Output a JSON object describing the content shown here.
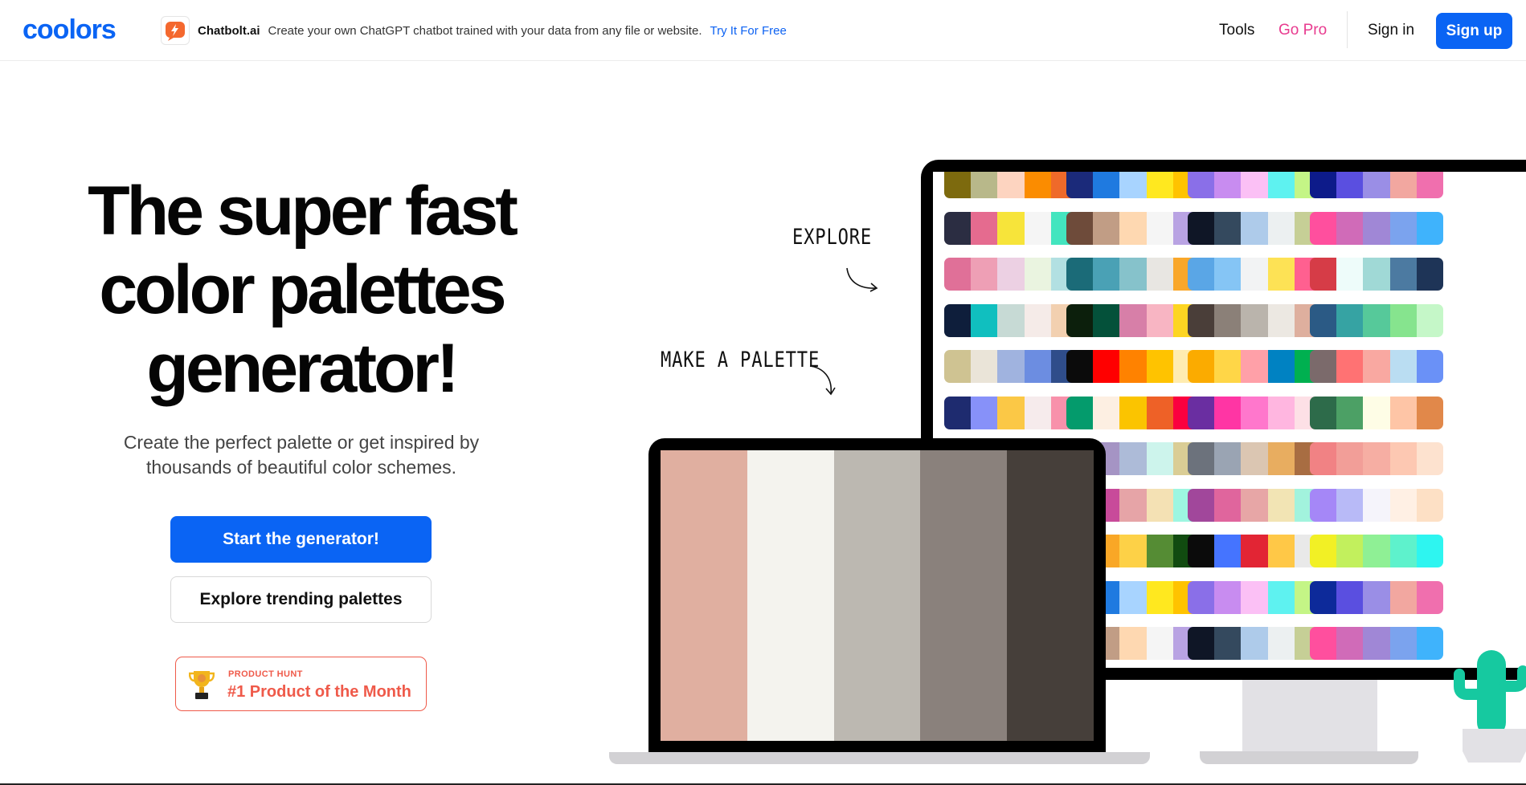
{
  "header": {
    "logo_text": "coolors",
    "ad": {
      "brand": "Chatbolt.ai",
      "text": "Create your own ChatGPT chatbot trained with your data from any file or website.",
      "link": "Try It For Free"
    },
    "nav": {
      "tools": "Tools",
      "go_pro": "Go Pro",
      "sign_in": "Sign in",
      "sign_up": "Sign up"
    }
  },
  "hero": {
    "title_lines": [
      "The super fast",
      "color palettes",
      "generator!"
    ],
    "subtitle_lines": [
      "Create the perfect palette or get inspired by",
      "thousands of beautiful color schemes."
    ],
    "primary_button": "Start the generator!",
    "secondary_button": "Explore trending palettes",
    "badge": {
      "label": "PRODUCT HUNT",
      "title": "#1 Product of the Month"
    }
  },
  "illustration": {
    "explore_label": "EXPLORE",
    "make_label": "MAKE A PALETTE",
    "laptop_palette": [
      "#e0afa0",
      "#f4f3ee",
      "#bcb8b1",
      "#8a817c",
      "#463f3a"
    ],
    "monitor_palettes": [
      [
        [
          "#7d6a0e",
          "#b8b88a",
          "#fdd4c0",
          "#fb8c00",
          "#ef6a2a"
        ],
        [
          "#1b2a7a",
          "#1f7ae0",
          "#a8d4ff",
          "#ffe81f",
          "#ffc300"
        ],
        [
          "#8a6fe8",
          "#c88cf0",
          "#fbc0f5",
          "#5ef2f0",
          "#c4f586"
        ],
        [
          "#0d1b8a",
          "#5a4fe0",
          "#9a8ee6",
          "#f2a7a0",
          "#f06fae"
        ]
      ],
      [
        [
          "#2b2d42",
          "#e56b8f",
          "#f7e43a",
          "#f5f5f5",
          "#43e5bf"
        ],
        [
          "#6e4b3a",
          "#c19d85",
          "#fed8b1",
          "#f5f5f5",
          "#b9a3e3"
        ],
        [
          "#0f1626",
          "#34495e",
          "#aecbea",
          "#ecf0f1",
          "#c6cf96"
        ],
        [
          "#ff4f9e",
          "#d06bb8",
          "#a087d6",
          "#7ba3ee",
          "#3fb3fc"
        ]
      ],
      [
        [
          "#e07098",
          "#ee9fb5",
          "#ecd0e3",
          "#eaf4e0",
          "#b2e0e2"
        ],
        [
          "#1b6b78",
          "#4aa1b5",
          "#86c2cb",
          "#e8e6e2",
          "#f9a72a"
        ],
        [
          "#5aa6e6",
          "#85c5f5",
          "#f2f3f4",
          "#fde255",
          "#ff6090"
        ],
        [
          "#d63c47",
          "#eefcfa",
          "#a0d9d6",
          "#4c7aa1",
          "#1e3457"
        ]
      ],
      [
        [
          "#0e1e3b",
          "#10bfbf",
          "#c7dad5",
          "#f5ebe8",
          "#f2d0b0"
        ],
        [
          "#0c1f0c",
          "#04513a",
          "#d77fa8",
          "#f8b5c3",
          "#fdd522"
        ],
        [
          "#4a3e39",
          "#8b8078",
          "#bab4ac",
          "#ece8e2",
          "#deaf9e"
        ],
        [
          "#2b5a85",
          "#36a3a3",
          "#56c99a",
          "#86e48e",
          "#c5f7c8"
        ]
      ],
      [
        [
          "#cfc392",
          "#eae4d8",
          "#a0b3df",
          "#6c8de1",
          "#2f4d8a"
        ],
        [
          "#0b0b0b",
          "#ff0000",
          "#ff8200",
          "#ffc300",
          "#ffecb0"
        ],
        [
          "#fbab00",
          "#ffd647",
          "#ffa0a8",
          "#0082c2",
          "#00b050"
        ],
        [
          "#7b6a6b",
          "#ff7273",
          "#f9a8a1",
          "#baddf2",
          "#6a91f7"
        ]
      ],
      [
        [
          "#1e2b6f",
          "#8791f9",
          "#fbc846",
          "#f6ebec",
          "#f891ab"
        ],
        [
          "#049b6c",
          "#fdefe2",
          "#fbc400",
          "#ee6127",
          "#fb003f"
        ],
        [
          "#6a2ea1",
          "#ff35a4",
          "#ff77cc",
          "#ffb6e0",
          "#fde0e6"
        ],
        [
          "#2d6b4a",
          "#4ca065",
          "#fefde6",
          "#fec5a6",
          "#e1884a"
        ]
      ],
      [
        [
          "#9fe6d6",
          "#c8f0e8",
          "#f6f6f6",
          "#ffd6d6",
          "#ffa7a7"
        ],
        [
          "#6e5d8c",
          "#a594c4",
          "#adbbd8",
          "#cdf4ec",
          "#dacd95"
        ],
        [
          "#6c727c",
          "#9aa4b3",
          "#dbc6b2",
          "#e8ad60",
          "#a86d42"
        ],
        [
          "#f18284",
          "#f29e98",
          "#f6aea3",
          "#fdc8b2",
          "#fde2cf"
        ]
      ],
      [
        [
          "#f15d5d",
          "#ff6b6b",
          "#e29598",
          "#d3b4bb",
          "#a0f0f4"
        ],
        [
          "#ab1e6e",
          "#c84a9a",
          "#e6a4a7",
          "#f4e1b4",
          "#9df6e1"
        ],
        [
          "#a1479b",
          "#e0659d",
          "#e7a6a6",
          "#f2e4b4",
          "#a2f3dd"
        ],
        [
          "#a587f7",
          "#b8baf7",
          "#f5f4fb",
          "#fff0e4",
          "#fde0c5"
        ]
      ],
      [
        [
          "#f7a23b",
          "#a8dbe2",
          "#f9a726",
          "#fdd147",
          "#558c34"
        ],
        [
          "#a8dbe2",
          "#f9a726",
          "#fdd147",
          "#558c34",
          "#114b10"
        ],
        [
          "#0b0b0b",
          "#4574ff",
          "#e22534",
          "#ffc847",
          "#e9e9e9"
        ],
        [
          "#f2f025",
          "#c2f05d",
          "#8ff095",
          "#5ef2cc",
          "#2ef5f0"
        ]
      ],
      [
        [
          "#1b2a7a",
          "#1f7ae0",
          "#a8d4ff",
          "#ffe81f",
          "#ffc300"
        ],
        [
          "#1b2a7a",
          "#1f7ae0",
          "#a8d4ff",
          "#ffe81f",
          "#ffc300"
        ],
        [
          "#8a6fe8",
          "#c88cf0",
          "#fbc0f5",
          "#5ef2f0",
          "#c4f586"
        ],
        [
          "#0d2a9a",
          "#5a4fe0",
          "#9a8ee6",
          "#f2a7a0",
          "#f06fae"
        ]
      ],
      [
        [
          "#6e4b3a",
          "#c19d85",
          "#fed8b1",
          "#f5f5f5",
          "#b9a3e3"
        ],
        [
          "#6e4b3a",
          "#c19d85",
          "#fed8b1",
          "#f5f5f5",
          "#b9a3e3"
        ],
        [
          "#0f1626",
          "#34495e",
          "#aecbea",
          "#ecf0f1",
          "#c6cf96"
        ],
        [
          "#ff4f9e",
          "#d06bb8",
          "#a087d6",
          "#7ba3ee",
          "#3fb3fc"
        ]
      ],
      [
        [
          "#1b6b78",
          "#4aa1b5",
          "#86c2cb",
          "#e8e6e2",
          "#f9a72a"
        ],
        [
          "#1b6b78",
          "#4aa1b5",
          "#86c2cb",
          "#e8e6e2",
          "#f9a72a"
        ],
        [
          "#5aa6e6",
          "#85c5f5",
          "#f2f3f4",
          "#fde255",
          "#ff6090"
        ],
        [
          "#d63c47",
          "#eefcfa",
          "#a0d9d6",
          "#4c7aa1",
          "#1e3457"
        ]
      ]
    ]
  }
}
